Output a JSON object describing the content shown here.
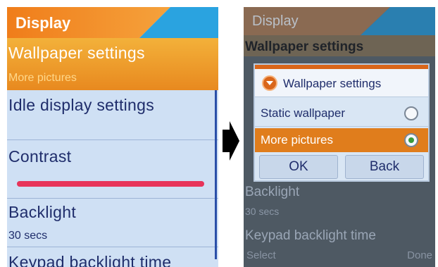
{
  "left_screen": {
    "title": "Display",
    "items": [
      {
        "label": "Wallpaper settings",
        "sub": "More pictures"
      },
      {
        "label": "Idle display settings"
      },
      {
        "label": "Contrast"
      },
      {
        "label": "Backlight",
        "sub": "30 secs"
      },
      {
        "label": "Keypad backlight time"
      }
    ],
    "contrast_level": 1.0
  },
  "right_screen": {
    "title": "Display",
    "background_items": [
      {
        "label": "Wallpaper settings"
      },
      {
        "label": "Backlight",
        "sub": "30 secs"
      },
      {
        "label": "Keypad backlight time"
      }
    ],
    "dialog": {
      "title": "Wallpaper settings",
      "options": [
        {
          "label": "Static wallpaper",
          "selected": false
        },
        {
          "label": "More pictures",
          "selected": true
        }
      ],
      "ok_label": "OK",
      "back_label": "Back"
    },
    "softkeys": {
      "left": "Select",
      "right": "Done"
    }
  },
  "colors": {
    "accent_orange": "#e8891f",
    "title_blue": "#2aa3e0",
    "text_navy": "#1f2d6b",
    "list_background": "#cfe0f4",
    "contrast_bar": "#e8345a"
  },
  "icons": {
    "arrow": "arrow-right-icon",
    "dialog": "chevron-down-circle-icon",
    "radio_off": "radio-unchecked-icon",
    "radio_on": "radio-checked-icon"
  }
}
